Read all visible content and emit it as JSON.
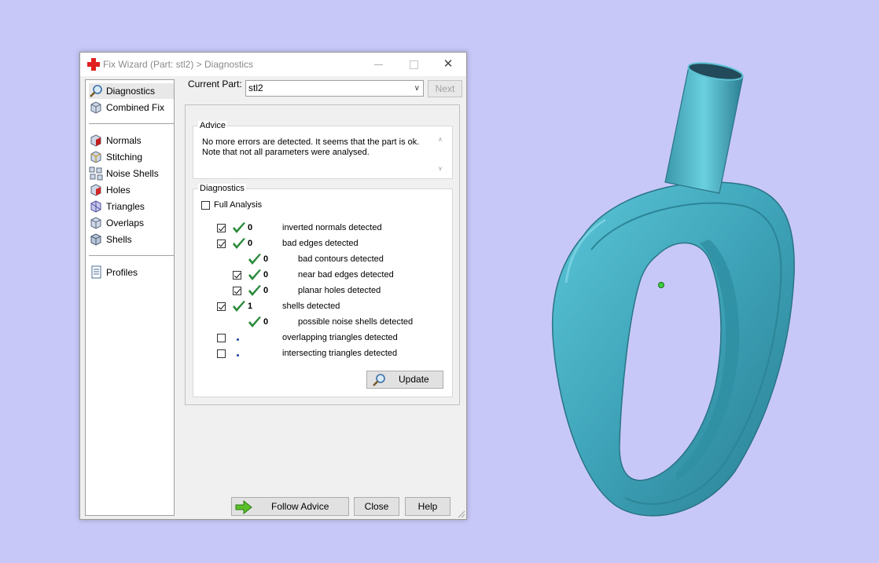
{
  "window": {
    "title": "Fix Wizard (Part: stl2) > Diagnostics",
    "close_glyph": "✕"
  },
  "nav": {
    "top_items": [
      {
        "label": "Diagnostics",
        "icon": "magnifier-icon",
        "selected": true
      },
      {
        "label": "Combined Fix",
        "icon": "cube-icon"
      }
    ],
    "fix_items": [
      {
        "label": "Normals",
        "icon": "normals-cube-icon"
      },
      {
        "label": "Stitching",
        "icon": "stitching-cube-icon"
      },
      {
        "label": "Noise Shells",
        "icon": "noise-shells-icon"
      },
      {
        "label": "Holes",
        "icon": "holes-cube-icon"
      },
      {
        "label": "Triangles",
        "icon": "triangles-cube-icon"
      },
      {
        "label": "Overlaps",
        "icon": "overlaps-cube-icon"
      },
      {
        "label": "Shells",
        "icon": "shells-cube-icon"
      }
    ],
    "bottom_items": [
      {
        "label": "Profiles",
        "icon": "profiles-document-icon"
      }
    ]
  },
  "current_part": {
    "label": "Current Part:",
    "value": "stl2",
    "next_label": "Next"
  },
  "advice": {
    "title": "Advice",
    "text_line1": "No more errors are detected. It seems that the part is ok.",
    "text_line2": "Note that not all parameters were analysed."
  },
  "diagnostics": {
    "title": "Diagnostics",
    "full_analysis_label": "Full Analysis",
    "full_analysis_checked": false,
    "rows": [
      {
        "checkbox": true,
        "checked": true,
        "status": "ok",
        "count": "0",
        "label": "inverted normals detected",
        "indent": 0
      },
      {
        "checkbox": true,
        "checked": true,
        "status": "ok",
        "count": "0",
        "label": "bad edges detected",
        "indent": 0
      },
      {
        "checkbox": false,
        "checked": false,
        "status": "ok",
        "count": "0",
        "label": "bad contours detected",
        "indent": 1
      },
      {
        "checkbox": true,
        "checked": true,
        "status": "ok",
        "count": "0",
        "label": "near bad edges detected",
        "indent": 1
      },
      {
        "checkbox": true,
        "checked": true,
        "status": "ok",
        "count": "0",
        "label": "planar holes detected",
        "indent": 1
      },
      {
        "checkbox": true,
        "checked": true,
        "status": "ok",
        "count": "1",
        "label": "shells detected",
        "indent": 0
      },
      {
        "checkbox": false,
        "checked": false,
        "status": "ok",
        "count": "0",
        "label": "possible noise shells detected",
        "indent": 1
      },
      {
        "checkbox": true,
        "checked": false,
        "status": "pending",
        "count": "",
        "label": "overlapping triangles detected",
        "indent": 0
      },
      {
        "checkbox": true,
        "checked": false,
        "status": "pending",
        "count": "",
        "label": "intersecting triangles detected",
        "indent": 0
      }
    ],
    "update_label": "Update"
  },
  "footer": {
    "follow_advice_label": "Follow Advice",
    "close_label": "Close",
    "help_label": "Help"
  },
  "colors": {
    "background": "#c8c8f8",
    "model": "#4aaec0",
    "check_green": "#2a8a3a"
  }
}
